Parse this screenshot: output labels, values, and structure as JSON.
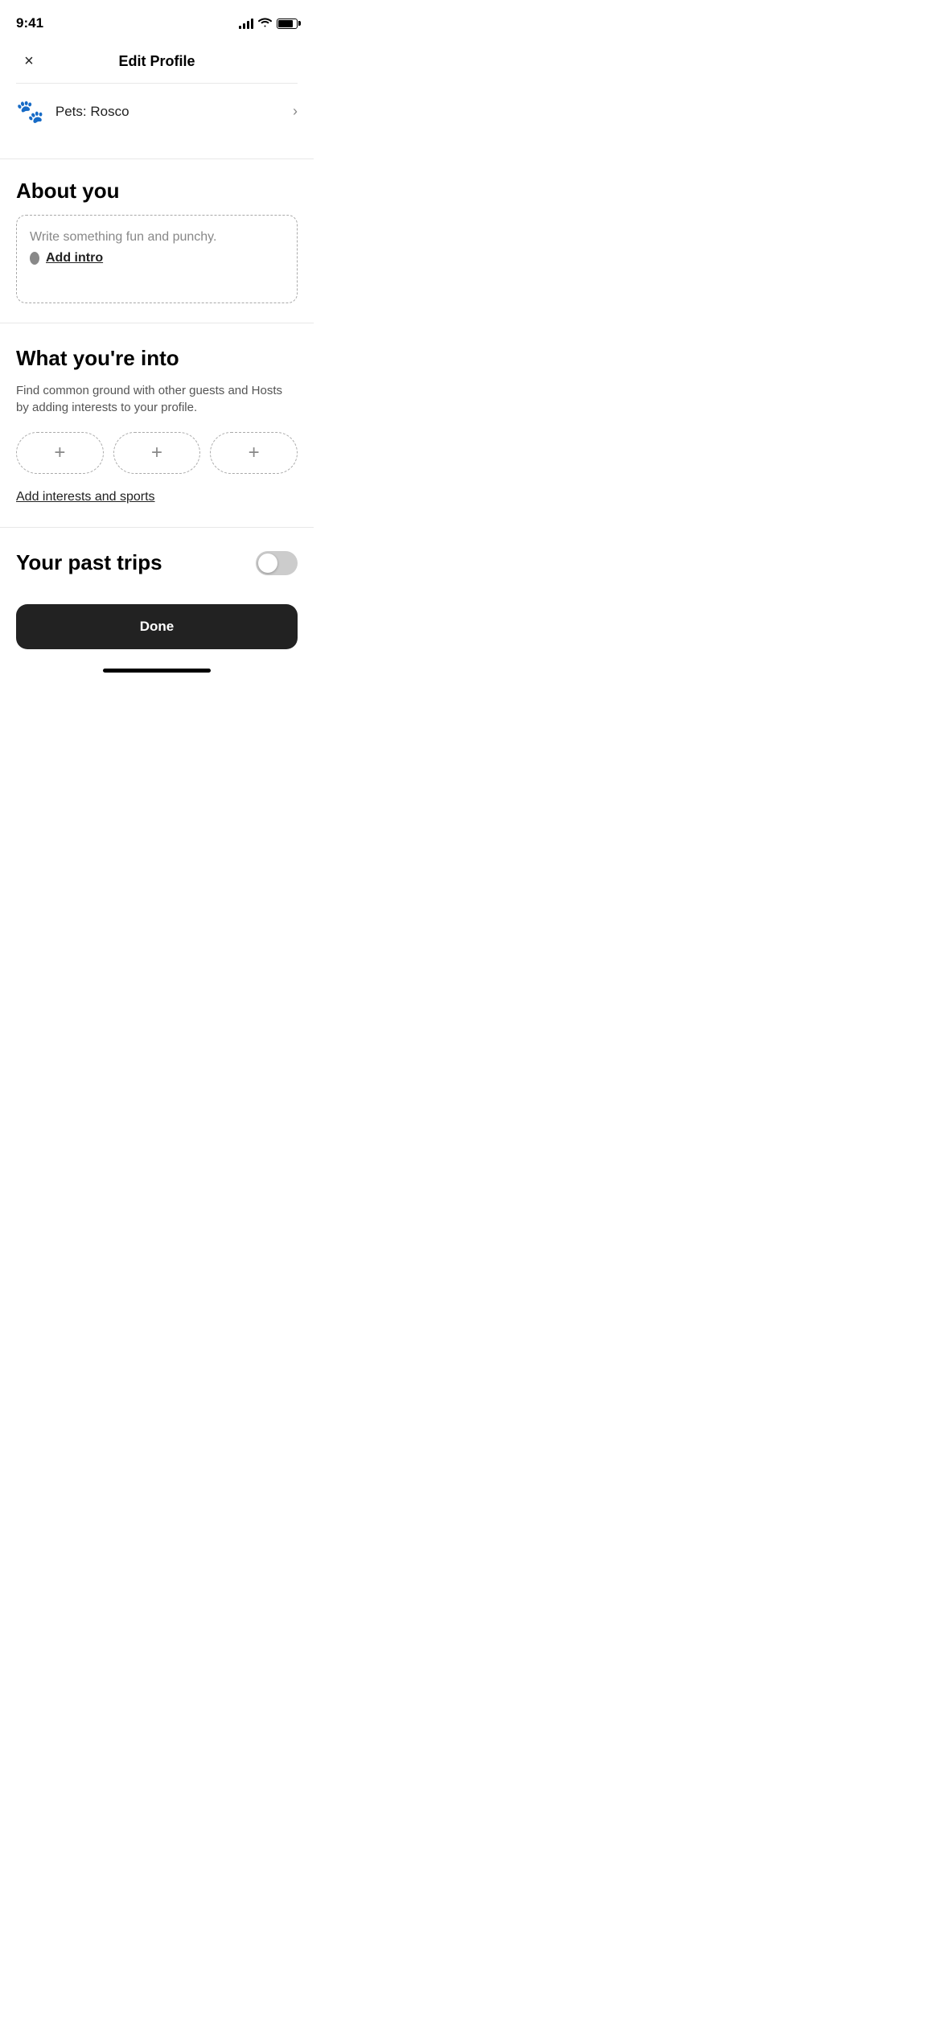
{
  "statusBar": {
    "time": "9:41"
  },
  "header": {
    "title": "Edit Profile",
    "closeLabel": "×"
  },
  "petsRow": {
    "icon": "🐾",
    "label": "Pets: Rosco",
    "chevron": "›"
  },
  "aboutYou": {
    "sectionTitle": "About you",
    "placeholder": "Write something fun and punchy.",
    "addLinkLabel": "Add intro"
  },
  "whatYoureInto": {
    "sectionTitle": "What you're into",
    "description": "Find common ground with other guests and Hosts by adding interests to your profile.",
    "chips": [
      "+",
      "+",
      "+"
    ],
    "addLinkLabel": "Add interests and sports"
  },
  "yourPastTrips": {
    "sectionTitle": "Your past trips",
    "toggleEnabled": false
  },
  "doneButton": {
    "label": "Done"
  }
}
